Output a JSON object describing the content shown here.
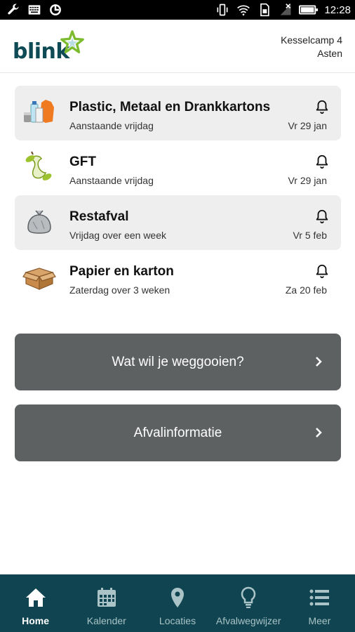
{
  "status_bar": {
    "time": "12:28",
    "left_icons": [
      "wrench-icon",
      "keyboard-icon",
      "sync-icon"
    ],
    "right_icons": [
      "vibrate-icon",
      "wifi-icon",
      "sim-icon",
      "signal-icon",
      "battery-icon"
    ]
  },
  "header": {
    "logo_text": "blink",
    "address_line1": "Kesselcamp 4",
    "address_line2": "Asten"
  },
  "schedule": [
    {
      "title": "Plastic, Metaal en Drankkartons",
      "subtitle": "Aanstaande vrijdag",
      "date": "Vr 29 jan",
      "icon": "pmd-waste-icon",
      "shaded": true
    },
    {
      "title": "GFT",
      "subtitle": "Aanstaande vrijdag",
      "date": "Vr 29 jan",
      "icon": "apple-core-icon",
      "shaded": false
    },
    {
      "title": "Restafval",
      "subtitle": "Vrijdag over een week",
      "date": "Vr 5 feb",
      "icon": "garbage-bag-icon",
      "shaded": true
    },
    {
      "title": "Papier en karton",
      "subtitle": "Zaterdag over 3 weken",
      "date": "Za 20 feb",
      "icon": "cardboard-box-icon",
      "shaded": false
    }
  ],
  "buttons": {
    "dispose_label": "Wat wil je weggooien?",
    "info_label": "Afvalinformatie"
  },
  "bottom_nav": [
    {
      "label": "Home",
      "icon": "home-icon",
      "active": true
    },
    {
      "label": "Kalender",
      "icon": "calendar-icon",
      "active": false
    },
    {
      "label": "Locaties",
      "icon": "location-pin-icon",
      "active": false
    },
    {
      "label": "Afvalwegwijzer",
      "icon": "lightbulb-icon",
      "active": false
    },
    {
      "label": "Meer",
      "icon": "menu-list-icon",
      "active": false
    }
  ],
  "colors": {
    "brand_dark": "#0f4450",
    "logo_green": "#7dbb2e",
    "button_gray": "#5e6162",
    "row_shade": "#eeeeee"
  }
}
